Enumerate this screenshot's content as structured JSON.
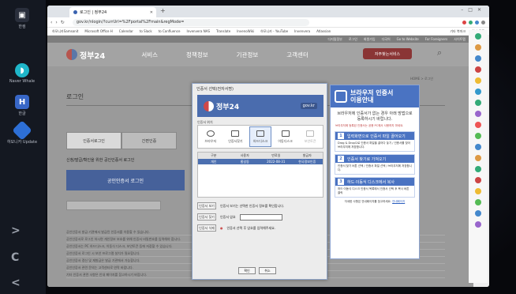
{
  "taskbar": {
    "items": [
      {
        "label": "한컴"
      },
      {
        "label": "Naver Whale"
      },
      {
        "label": "한글"
      },
      {
        "label": "하모니카 Update"
      }
    ],
    "nav": [
      ">",
      "C",
      "<"
    ]
  },
  "browser": {
    "tab_title": "로그인 | 정부24",
    "url": "gov.kr/nlogin/?currUrl=%2Fportal%2Fmain&regMode=",
    "bookmarks": [
      "하모니카Samsonit",
      "Microsoft Office H",
      "Calendar",
      "to Slack",
      "to Confluence",
      "Invenvera NAS",
      "Translate",
      "InvenoWiki",
      "하모니카 - YouTube",
      "Invenvera",
      "Atlassian"
    ],
    "bookmarks_right": [
      "기타 북마크",
      "읽기 목록"
    ]
  },
  "site": {
    "top_links": [
      "다지털정부",
      "로그인",
      "회원가입",
      "다국어",
      "Go to Website",
      "For Foreigners",
      "사이트맵"
    ],
    "logo": "정부24",
    "menu": [
      "서비스",
      "정책정보",
      "기관정보",
      "고객센터"
    ],
    "cta": "자주찾는서비스",
    "page_title": "로그인",
    "breadcrumb": "HOME > 로그인",
    "tabs": [
      "인증서로그인",
      "간편인증",
      "아이디로그인"
    ],
    "login_heading": "신청/발급/확인을 위한 공인인증서 로그인",
    "login_button": "공인인증서 로그인",
    "notes": [
      "공인인증서 발급 기관에서 발급된 인증서를 이용할 수 있습니다.",
      "공인인증서로 로그인 하시면 개인정보 보호를 위해 인증서 비밀번호를 입력해야 합니다.",
      "공인인증서는 PC 하드디스크, 이동식 디스크, 보안토큰 등에 저장할 수 있습니다.",
      "공인인증서 로그인 시 보안 프로그램 설치가 필요합니다.",
      "공인인증서 갱신 및 재발급은 발급 기관에서 가능합니다.",
      "공인인증서 관련 문의는 고객센터로 연락 바랍니다.",
      "기타 인증서 관련 사항은 안내 페이지를 참고하시기 바랍니다."
    ]
  },
  "dialog": {
    "title": "인증서 선택(전자서명)",
    "banner_logo": "정부24",
    "banner_domain": "gov.kr",
    "location_label": "인증서 위치",
    "locations": [
      "브라우저",
      "인증서찾기",
      "하드디스크",
      "이동디스크",
      "보안토큰"
    ],
    "table_headers": [
      "구분",
      "사용자",
      "만료일",
      "발급자"
    ],
    "table_rows": [
      [
        "개인",
        "홍길동",
        "2022-08-31",
        "한국정보인증"
      ]
    ],
    "buttons": {
      "view": "인증서 보기",
      "search": "인증서 찾기",
      "delete": "인증서 삭제",
      "ok": "확인",
      "cancel": "취소"
    },
    "password_label": "인증서 암호",
    "hint1": "인증서 보기는 선택한 인증서 정보를 확인합니다.",
    "hint2": "인증서 선택 후 암호를 입력해주세요."
  },
  "guide": {
    "title_line1": "브라우저 인증서",
    "title_line2": "이용안내",
    "subtitle": "브라우저에 인증서가 없는 경우 아래 방법으로 등록하시기 바랍니다.",
    "warning": "브라우저에 등록된 인증서는 공용 PC에서 사용하지 마세요.",
    "steps": [
      {
        "num": "1",
        "title": "입력화면으로 인증서 파일 끌어오기",
        "desc": "Drag & Drop으로 인증서 파일을 끌어다 놓기 / 인증서를 찾아 브라우저에 저장합니다."
      },
      {
        "num": "2",
        "title": "인증서 찾기로 가져오기",
        "desc": "인증서 찾기 버튼 선택 / 인증서 파일 선택 / 브라우저에 저장합니다."
      },
      {
        "num": "3",
        "title": "하드·이동식 디스크에서 복사",
        "desc": "하드·이동식 디스크 인증서 목록에서 인증서 선택 후 복사 버튼 클릭"
      }
    ],
    "footer": "자세한 사항은 안내페이지를 참고하세요.",
    "footer_link": "안내페이지"
  }
}
